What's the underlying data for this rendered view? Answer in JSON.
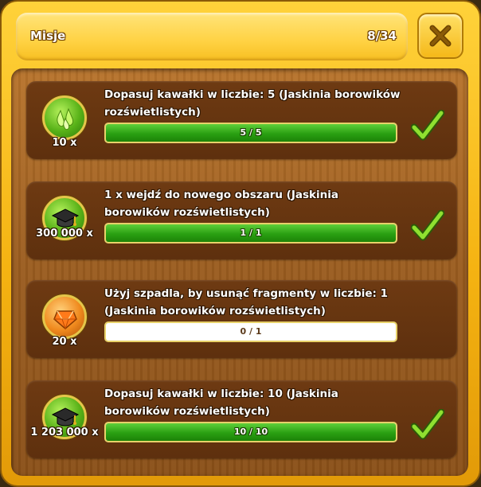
{
  "header": {
    "title": "Misje",
    "count": "8/34"
  },
  "colors": {
    "frame": "#f5b312",
    "panel": "#6e3a12",
    "progress_green": "#2aa012",
    "check_green": "#7cd82a"
  },
  "missions": [
    {
      "text": "Dopasuj kawałki w liczbie: 5 (Jaskinia borowików rozświetlistych)",
      "reward_icon": "green-drops-icon",
      "reward_amount": "10 x",
      "progress_label": "5 / 5",
      "progress": 1.0,
      "completed": true
    },
    {
      "text": "1 x wejdź do nowego obszaru (Jaskinia borowików rozświetlistych)",
      "reward_icon": "graduation-cap-icon",
      "reward_amount": "300 000 x",
      "progress_label": "1 / 1",
      "progress": 1.0,
      "completed": true
    },
    {
      "text": "Użyj szpadla, by usunąć fragmenty w liczbie: 1 (Jaskinia borowików rozświetlistych)",
      "reward_icon": "orange-gem-icon",
      "reward_amount": "20 x",
      "progress_label": "0 / 1",
      "progress": 0.0,
      "completed": false
    },
    {
      "text": "Dopasuj kawałki w liczbie: 10 (Jaskinia borowików rozświetlistych)",
      "reward_icon": "graduation-cap-icon",
      "reward_amount": "1 203 000 x",
      "progress_label": "10 / 10",
      "progress": 1.0,
      "completed": true
    }
  ]
}
